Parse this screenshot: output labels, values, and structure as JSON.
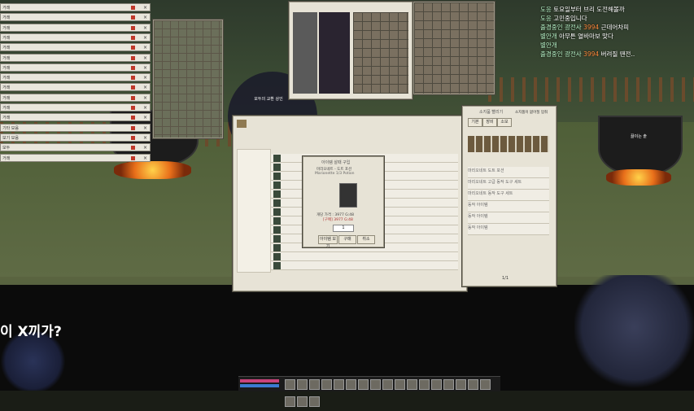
{
  "chat": [
    {
      "name": "도응",
      "msg": "토요일부터 브리 도전해볼까"
    },
    {
      "name": "도응",
      "msg": "고민중입니다"
    },
    {
      "name": "출경중인 광전사",
      "amount": "3994",
      "msg": "근데어차피"
    },
    {
      "name": "별안개",
      "msg": "아무튼 열바마보 맞다"
    },
    {
      "name": "별안개",
      "msg": ""
    },
    {
      "name": "출경중인 광전사",
      "amount": "3994",
      "msg": "버려질 땐전.."
    }
  ],
  "left_list": [
    "거래",
    "거래",
    "거래",
    "거래",
    "거래",
    "거래",
    "거래",
    "거래",
    "거래",
    "거래",
    "거래",
    "거래",
    "기타 모음",
    "보기 모음",
    "모두",
    "거래"
  ],
  "npc_label": "모두의 교환 상인",
  "cauldron_label": "끓이는 솥",
  "purchase_dialog": {
    "title": "아이템 살때 구입",
    "item_name": "마리오네트 - 도트 포션",
    "item_sub": "Marionette 1/3 Potion",
    "price_label": "개당 가격 : 3977 G:48",
    "price_sub": "[구매] 3977 G:48",
    "qty": "1",
    "buttons": [
      "아이템 보기",
      "구매",
      "취소"
    ]
  },
  "side_window": {
    "title": "소지품 빨리기",
    "tabs": [
      "기본",
      "장비",
      "소모"
    ],
    "check_label": "소지품이 없어질 멈춰",
    "items": [
      "마리오네트 도트 포션",
      "마리오네트 고급 동작 도구 세트",
      "마리오네트 동작 도구 세트",
      "동작 아이템",
      "동작 아이템",
      "동작 아이템"
    ],
    "page": "1/1"
  },
  "caption_left": "이 X끼가?",
  "colors": {
    "chat_name": "#b9f5c9",
    "gold": "#ff8a3c",
    "window_bg": "#e7e3d6"
  }
}
